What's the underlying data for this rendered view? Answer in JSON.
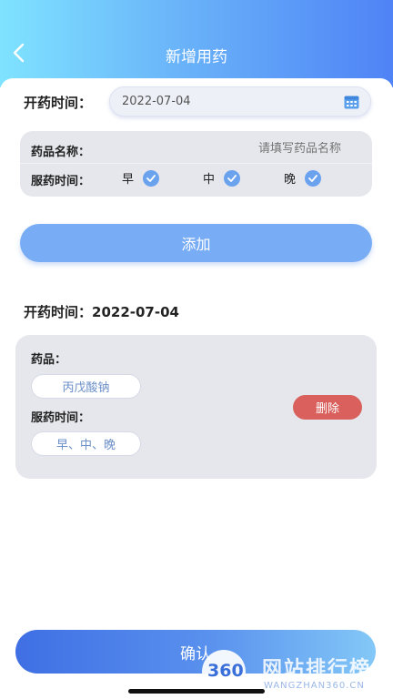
{
  "header": {
    "title": "新增用药"
  },
  "form": {
    "date_label": "开药时间：",
    "date_value": "2022-07-04",
    "drug_name_label": "药品名称：",
    "drug_name_placeholder": "请填写药品名称",
    "time_label": "服药时间：",
    "time_options": [
      {
        "label": "早",
        "checked": true
      },
      {
        "label": "中",
        "checked": true
      },
      {
        "label": "晚",
        "checked": true
      }
    ],
    "add_label": "添加"
  },
  "record": {
    "date_label": "开药时间：",
    "date_value": "2022-07-04",
    "drug_label": "药品：",
    "drug_value": "丙戊酸钠",
    "time_label": "服药时间：",
    "time_value": "早、中、晚",
    "delete_label": "删除"
  },
  "footer": {
    "confirm_label": "确认"
  },
  "watermark": {
    "logo_text": "360",
    "cn_text": "网站排行榜",
    "en_text": "WANGZHAN360.CN"
  },
  "colors": {
    "accent": "#5a92ee",
    "danger": "#d9605c",
    "check": "#6aa2ee"
  }
}
